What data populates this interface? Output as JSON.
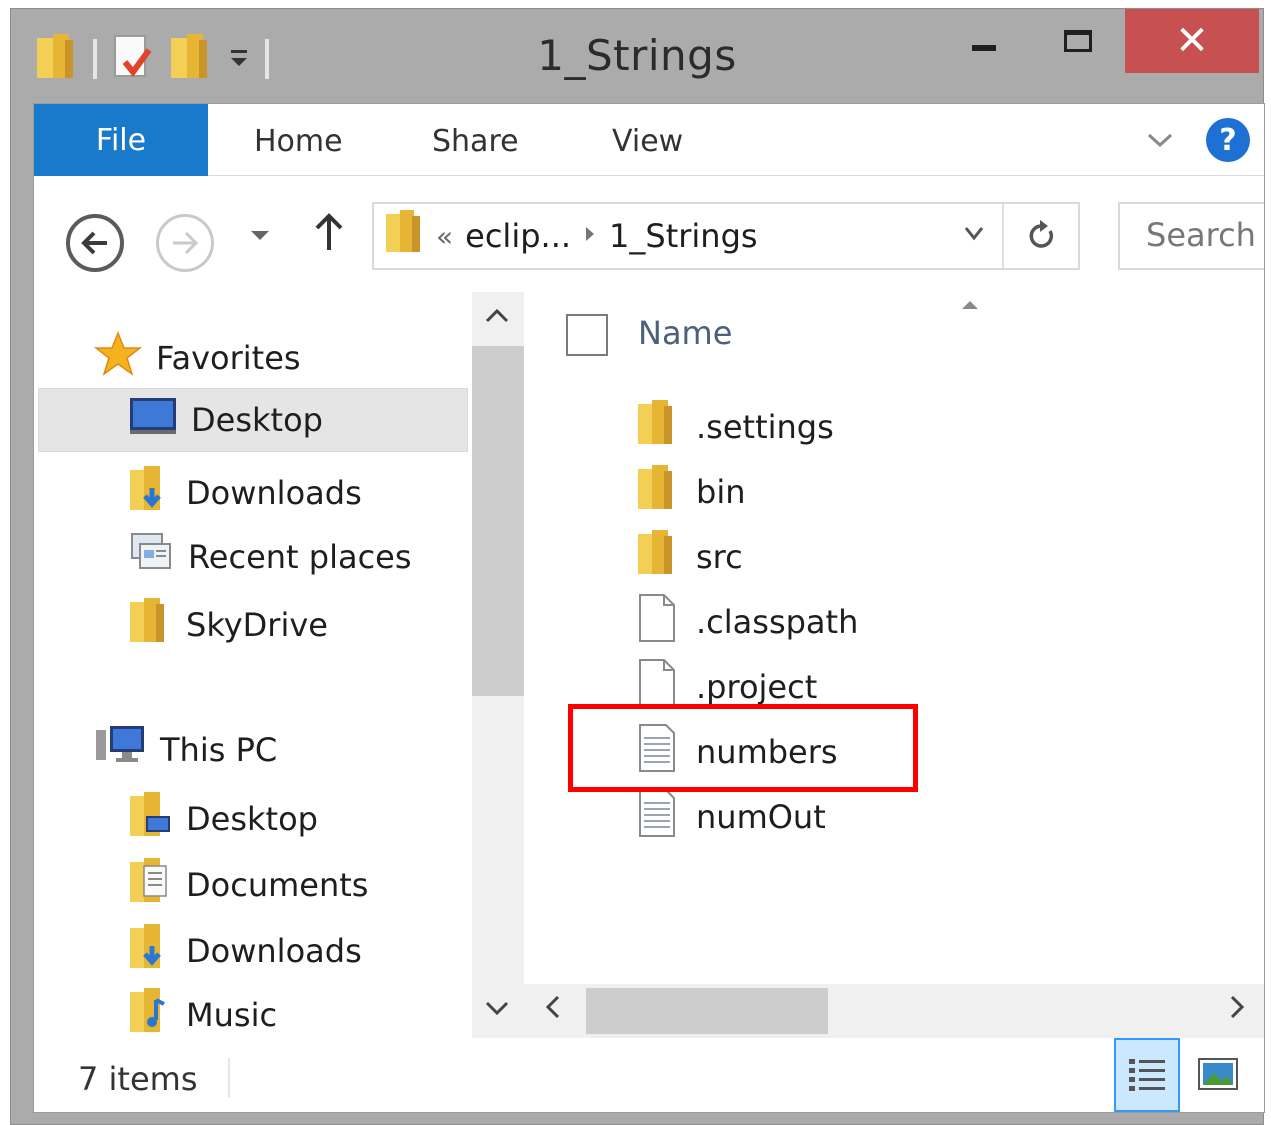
{
  "window": {
    "title": "1_Strings",
    "close_symbol": "✕"
  },
  "ribbon": {
    "file": "File",
    "home": "Home",
    "share": "Share",
    "view": "View",
    "help": "?"
  },
  "address": {
    "overflow": "«",
    "crumb_1": "eclip...",
    "crumb_2": "1_Strings",
    "search_placeholder": "Search"
  },
  "nav": {
    "favorites": "Favorites",
    "fav_desktop": "Desktop",
    "fav_downloads": "Downloads",
    "fav_recent": "Recent places",
    "fav_skydrive": "SkyDrive",
    "this_pc": "This PC",
    "pc_desktop": "Desktop",
    "pc_documents": "Documents",
    "pc_downloads": "Downloads",
    "pc_music": "Music"
  },
  "files": {
    "column_name": "Name",
    "items": [
      {
        "name": ".settings",
        "icon": "folder-icon"
      },
      {
        "name": "bin",
        "icon": "folder-icon"
      },
      {
        "name": "src",
        "icon": "folder-icon"
      },
      {
        "name": ".classpath",
        "icon": "file-icon"
      },
      {
        "name": ".project",
        "icon": "file-icon"
      },
      {
        "name": "numbers",
        "icon": "text-file-icon"
      },
      {
        "name": "numOut",
        "icon": "text-file-icon"
      }
    ]
  },
  "status": {
    "count": "7 items"
  },
  "colors": {
    "file_tab": "#1979ca",
    "close_button": "#c75050",
    "highlight": "#ff0000",
    "selected_view": "#cce8ff"
  }
}
